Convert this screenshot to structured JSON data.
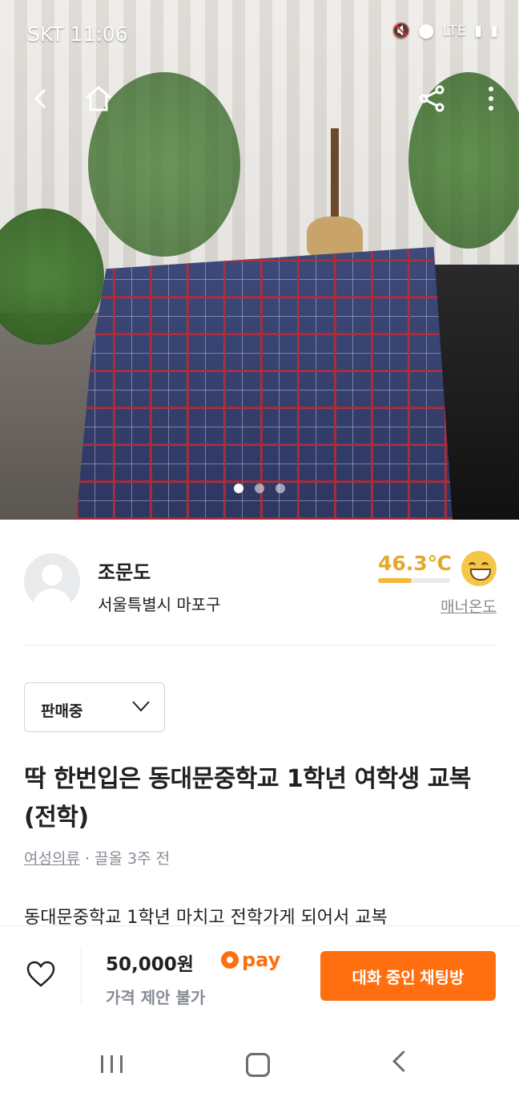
{
  "status_bar": {
    "carrier_time": "SKT 11:06",
    "network": "LTE"
  },
  "hero": {
    "image_description_icon": "photo",
    "pages": 3,
    "active_page": 0
  },
  "seller": {
    "name": "조문도",
    "location": "서울특별시 마포구",
    "temperature": "46.3℃",
    "temperature_level": 0.463,
    "manner_label": "매너온도"
  },
  "sale_status": {
    "selected": "판매중"
  },
  "post": {
    "title": "딱 한번입은 동대문중학교 1학년 여학생 교복(전학)",
    "category": "여성의류",
    "time": "· 끌올 3주 전",
    "description": "동대문중학교 1학년 마치고 전학가게 되어서 교복"
  },
  "bottom": {
    "price": "50,000원",
    "negotiation": "가격 제안 불가",
    "pay_label": "pay",
    "chat_button": "대화 중인 채팅방"
  },
  "colors": {
    "brand": "#ff6f0f",
    "temperature": "#e4a92c",
    "muted": "#868b94"
  }
}
